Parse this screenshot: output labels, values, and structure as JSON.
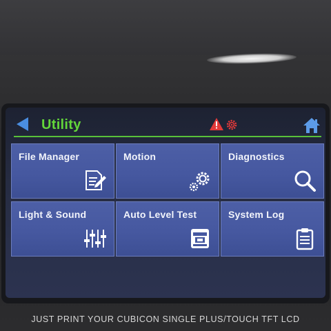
{
  "header": {
    "title": "Utility",
    "back_icon": "back-arrow-icon",
    "alert_icon": "warning-icon",
    "gear_alert_icon": "gear-alert-icon",
    "home_icon": "home-icon",
    "title_color": "#63d63a",
    "accent_line_color": "#59c13a",
    "back_color": "#4a8de0",
    "alert_color": "#e23a3a"
  },
  "tiles": [
    {
      "label": "File Manager",
      "icon": "file-edit-icon"
    },
    {
      "label": "Motion",
      "icon": "gears-icon"
    },
    {
      "label": "Diagnostics",
      "icon": "magnifier-icon"
    },
    {
      "label": "Light & Sound",
      "icon": "sliders-icon"
    },
    {
      "label": "Auto Level Test",
      "icon": "printer-bed-icon"
    },
    {
      "label": "System Log",
      "icon": "clipboard-icon"
    }
  ],
  "tile_color": "#4658a0",
  "device_caption": "JUST PRINT YOUR CUBICON SINGLE PLUS/TOUCH TFT LCD"
}
